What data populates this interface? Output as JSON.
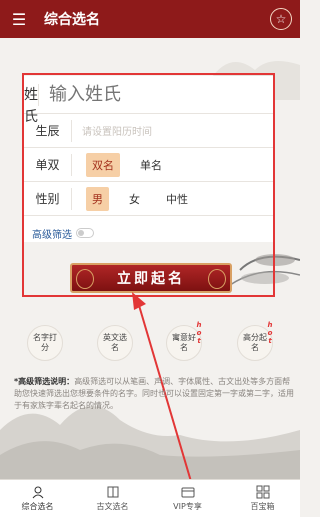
{
  "header": {
    "title": "综合选名",
    "menu_icon": "menu-icon",
    "fav_icon": "star-icon"
  },
  "form": {
    "surname_label": "姓氏",
    "surname_placeholder": "输入姓氏",
    "birth_label": "生辰",
    "birth_placeholder": "请设置阳历时间",
    "char_label": "单双",
    "char_options": [
      "双名",
      "单名"
    ],
    "char_selected": "双名",
    "gender_label": "性别",
    "gender_options": [
      "男",
      "女",
      "中性"
    ],
    "gender_selected": "男",
    "advanced_label": "高级筛选"
  },
  "submit_label": "立即起名",
  "tools": [
    {
      "label": "名字打分",
      "hot": ""
    },
    {
      "label": "英文选名",
      "hot": ""
    },
    {
      "label": "寓意好名",
      "hot": "hot"
    },
    {
      "label": "高分起名",
      "hot": "hot"
    }
  ],
  "description": {
    "title": "*高级筛选说明：",
    "body": "高级筛选可以从笔画、声调、字体属性、古文出处等多方面帮助您快速筛选出您想要条件的名字。同时也可以设置固定第一字或第二字，适用于有家族字辈名起名的情况。"
  },
  "nav": [
    {
      "label": "综合选名",
      "icon": "baby-icon"
    },
    {
      "label": "古文选名",
      "icon": "book-icon"
    },
    {
      "label": "VIP专享",
      "icon": "wallet-icon"
    },
    {
      "label": "百宝箱",
      "icon": "grid-icon"
    }
  ],
  "colors": {
    "header": "#8e1a1a",
    "highlight": "#e23636",
    "selected": "#f6cfa6"
  }
}
